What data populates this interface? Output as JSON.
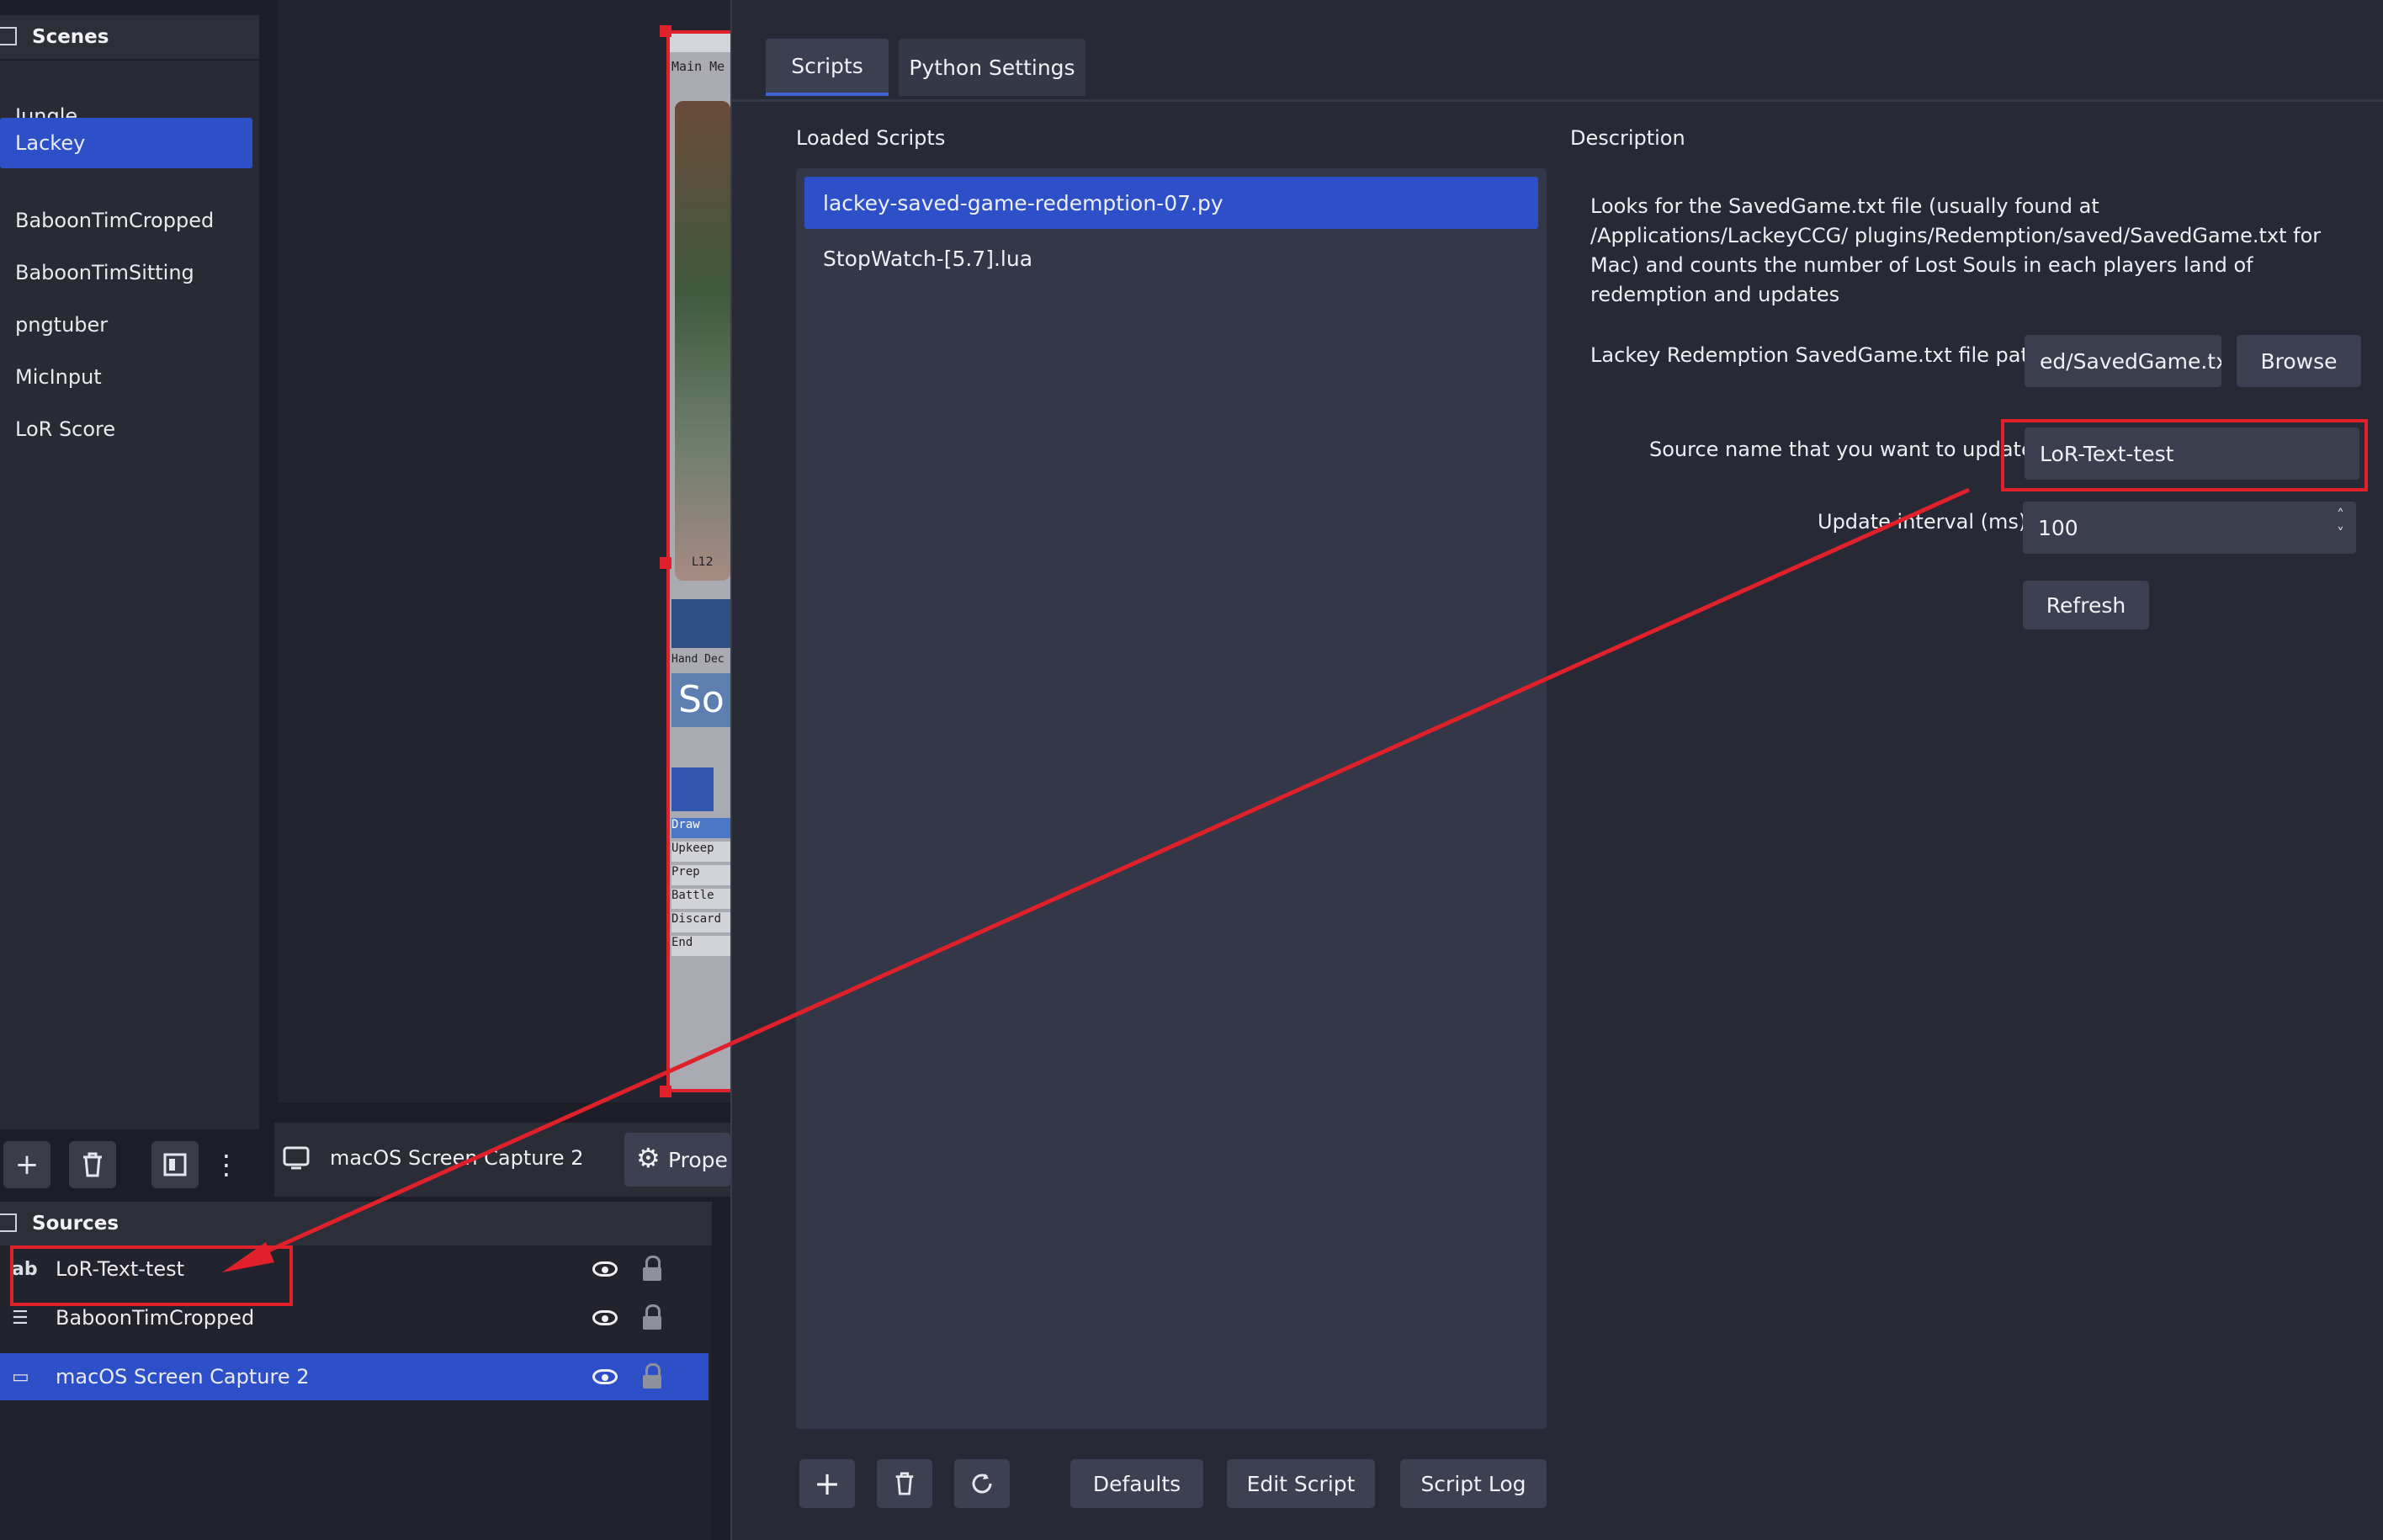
{
  "scenes": {
    "title": "Scenes",
    "items": [
      "Jungle",
      "Lackey",
      "BaboonTimCropped",
      "BaboonTimSitting",
      "pngtuber",
      "MicInput",
      "LoR Score"
    ],
    "selected_index": 1
  },
  "scene_toolbar": {
    "add": "+",
    "more": "⋮"
  },
  "source_bar": {
    "selected_source": "macOS Screen Capture 2",
    "properties_label": "Prope"
  },
  "sources": {
    "title": "Sources",
    "items": [
      {
        "icon": "text-icon",
        "icon_glyph": "ab",
        "label": "LoR-Text-test"
      },
      {
        "icon": "list-icon",
        "icon_glyph": "☰",
        "label": "BaboonTimCropped"
      },
      {
        "icon": "monitor-icon",
        "icon_glyph": "▭",
        "label": "macOS Screen Capture 2"
      }
    ],
    "selected_index": 2
  },
  "capture_preview": {
    "menu_text": "Main Me",
    "hand_text": "Hand Dec",
    "card_code": "L12",
    "logo_text": "So",
    "phases": [
      "Draw",
      "Upkeep",
      "Prep",
      "Battle",
      "Discard",
      "End"
    ]
  },
  "dialog": {
    "tabs": [
      "Scripts",
      "Python Settings"
    ],
    "active_tab": 0,
    "loaded_scripts_label": "Loaded Scripts",
    "scripts": [
      "lackey-saved-game-redemption-07.py",
      "StopWatch-[5.7].lua"
    ],
    "selected_script": 0,
    "description_label": "Description",
    "description_text": "Looks for the SavedGame.txt file (usually found at /Applications/LackeyCCG/ plugins/Redemption/saved/SavedGame.txt for Mac) and counts the number of Lost Souls in each players land of redemption and updates",
    "file_path_label": "Lackey Redemption SavedGame.txt file path:",
    "file_path_value": "ed/SavedGame.txt",
    "browse_label": "Browse",
    "source_name_label": "Source name that you want to update",
    "source_name_value": "LoR-Text-test",
    "interval_label": "Update interval (ms)",
    "interval_value": "100",
    "refresh_label": "Refresh",
    "bottom_buttons": {
      "defaults": "Defaults",
      "edit_script": "Edit Script",
      "script_log": "Script Log"
    }
  },
  "annotation_color": "#e0202a",
  "accent_color": "#2d50c8"
}
